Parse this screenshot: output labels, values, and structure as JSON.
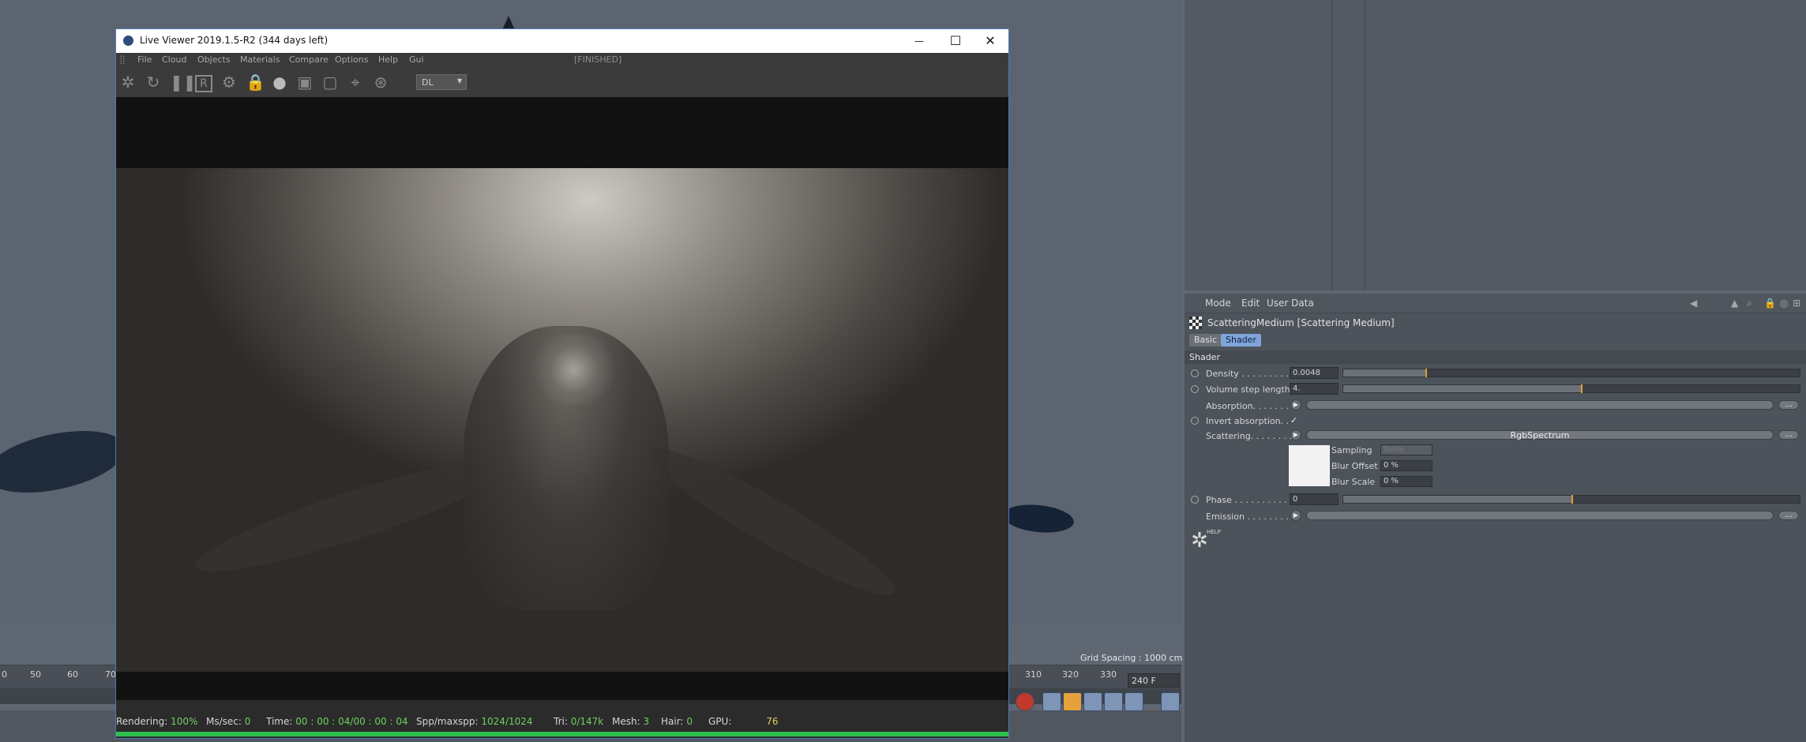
{
  "live_viewer": {
    "title": "Live Viewer 2019.1.5-R2 (344 days left)",
    "status": "[FINISHED]",
    "menu": [
      "File",
      "Cloud",
      "Objects",
      "Materials",
      "Compare",
      "Options",
      "Help",
      "Gui"
    ],
    "window_buttons": {
      "minimize": "—",
      "maximize": "☐",
      "close": "✕"
    },
    "render_kernel": "DL",
    "footer": {
      "rendering_label": "Rendering:",
      "rendering_value": "100%",
      "mssec_label": "Ms/sec:",
      "mssec_value": "0",
      "time_label": "Time:",
      "time_value": "00 : 00 : 04/00 : 00 : 04",
      "spp_label": "Spp/maxspp:",
      "spp_value": "1024/1024",
      "tri_label": "Tri:",
      "tri_value": "0/147k",
      "mesh_label": "Mesh:",
      "mesh_value": "3",
      "hair_label": "Hair:",
      "hair_value": "0",
      "gpu_label": "GPU:",
      "gpu_value": "76"
    }
  },
  "viewport": {
    "grid_spacing": "Grid Spacing : 1000 cm",
    "timeline_ticks_left": [
      "0",
      "50",
      "60",
      "70"
    ],
    "timeline_ticks_right": [
      "310",
      "320",
      "330"
    ],
    "end_frame": "240 F"
  },
  "attributes": {
    "menu": [
      "Mode",
      "Edit",
      "User Data"
    ],
    "object_title": "ScatteringMedium [Scattering Medium]",
    "tabs": [
      "Basic",
      "Shader"
    ],
    "section": "Shader",
    "density_label": "Density . . . . . . . . . .",
    "density_value": "0.0048",
    "density_level": 0.18,
    "step_label": "Volume step length",
    "step_value": "4.",
    "step_level": 0.52,
    "absorption_label": "Absorption. . . . . . . .",
    "invert_label": "Invert absorption. .",
    "invert_check": "✓",
    "scattering_label": "Scattering. . . . . . . . .",
    "scattering_button": "RgbSpectrum",
    "sampling_label": "Sampling",
    "sampling_value": "None",
    "blur_offset_label": "Blur Offset",
    "blur_offset_value": "0 %",
    "blur_scale_label": "Blur Scale",
    "blur_scale_value": "0 %",
    "phase_label": "Phase . . . . . . . . . . . .",
    "phase_value": "0",
    "phase_level": 0.5,
    "emission_label": "Emission . . . . . . . . .",
    "dots": "...",
    "help_text": "HELP"
  }
}
